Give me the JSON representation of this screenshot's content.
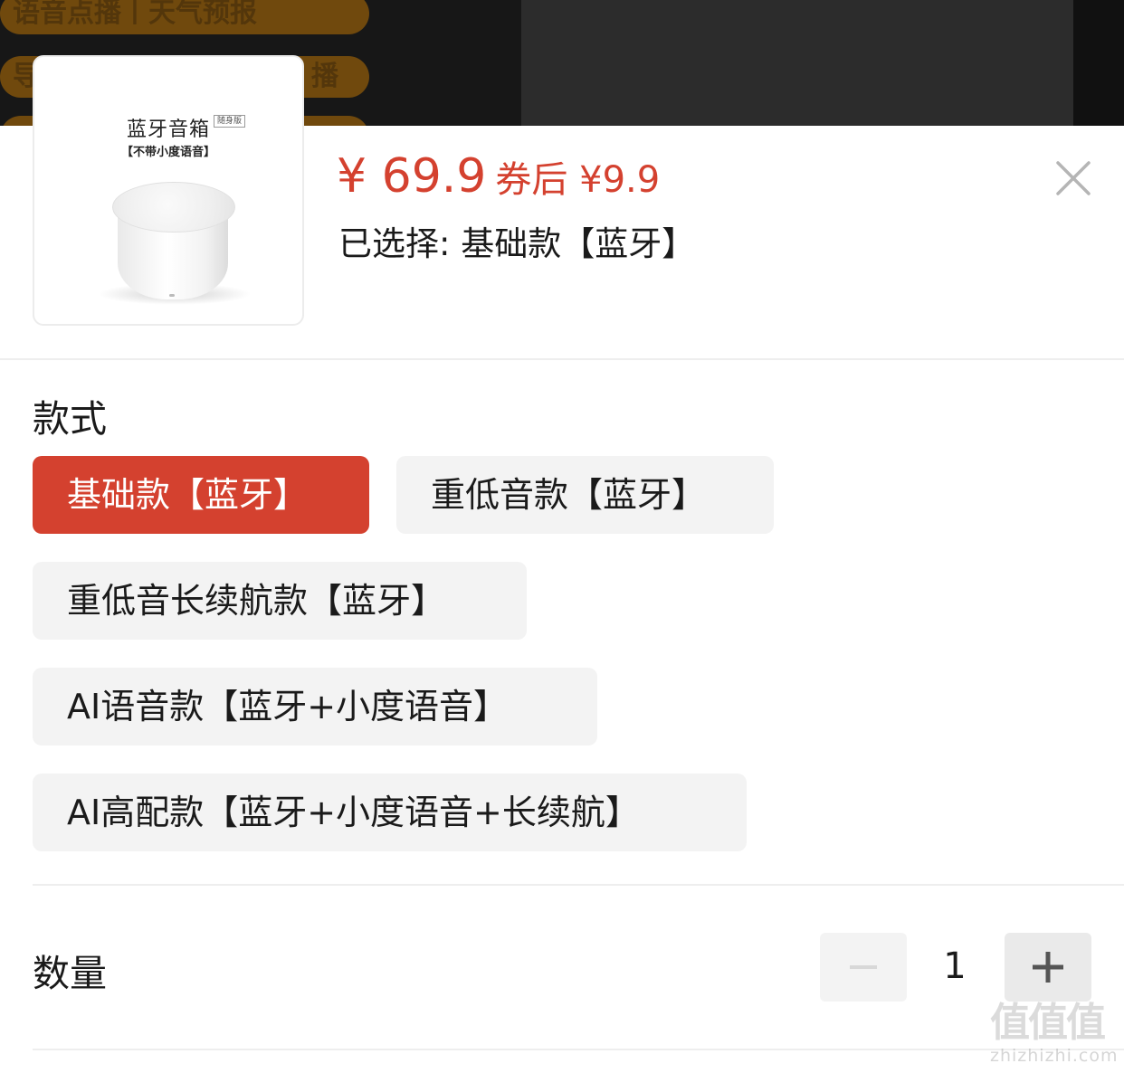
{
  "background": {
    "pills": [
      "语音点播丨天气预报",
      "导",
      "播"
    ]
  },
  "product": {
    "image": {
      "title": "蓝牙音箱",
      "tag": "随身版",
      "subtitle": "【不带小度语音】"
    },
    "price": "¥ 69.9",
    "coupon_price": "券后 ¥9.9",
    "selected": "已选择: 基础款【蓝牙】"
  },
  "style_section": {
    "title": "款式",
    "options": [
      {
        "label": "基础款【蓝牙】",
        "selected": true
      },
      {
        "label": "重低音款【蓝牙】",
        "selected": false
      },
      {
        "label": "重低音长续航款【蓝牙】",
        "selected": false
      },
      {
        "label": "AI语音款【蓝牙+小度语音】",
        "selected": false
      },
      {
        "label": "AI高配款【蓝牙+小度语音+长续航】",
        "selected": false
      }
    ]
  },
  "quantity": {
    "label": "数量",
    "value": "1",
    "decrease_enabled": false
  },
  "watermark": {
    "chars": "值值值",
    "url": "zhizhizhi.com"
  },
  "colors": {
    "accent": "#d4412f",
    "option_bg": "#f3f3f3",
    "sheet_bg": "#ffffff",
    "overlay_bg": "#1e1e1e"
  }
}
